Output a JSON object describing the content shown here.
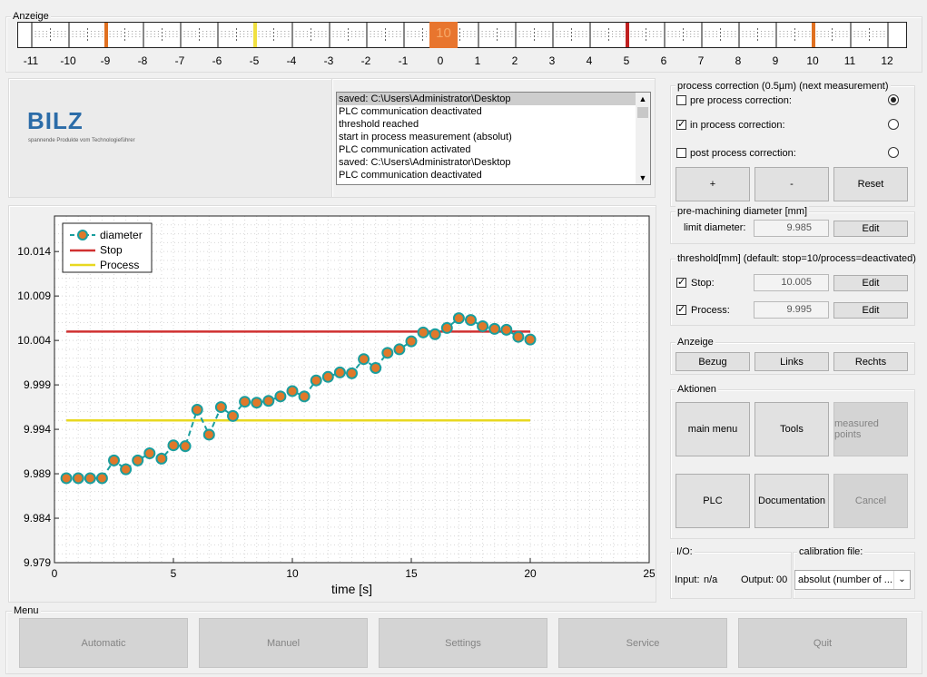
{
  "anzeige": {
    "title": "Anzeige",
    "scale_labels": [
      "-11",
      "-10",
      "-9",
      "-8",
      "-7",
      "-6",
      "-5",
      "-4",
      "-3",
      "-2",
      "-1",
      "0",
      "1",
      "2",
      "3",
      "4",
      "5",
      "6",
      "7",
      "8",
      "9",
      "10",
      "11",
      "12"
    ],
    "indicator_value": "10",
    "markers": [
      {
        "value": -9,
        "color": "#e07020"
      },
      {
        "value": -5,
        "color": "#f0e040"
      },
      {
        "value": 5,
        "color": "#c02020"
      },
      {
        "value": 10,
        "color": "#e07020"
      }
    ]
  },
  "logo": {
    "brand": "BILZ",
    "tagline": "spannende Produkte vom Technologieführer"
  },
  "log": {
    "entries": [
      "saved: C:\\Users\\Administrator\\Desktop",
      "PLC communication deactivated",
      "threshold reached",
      "start in process measurement (absolut)",
      "PLC communication activated",
      "saved: C:\\Users\\Administrator\\Desktop",
      "PLC communication deactivated"
    ]
  },
  "chart_data": {
    "type": "line",
    "xlabel": "time [s]",
    "ylabel": "",
    "xlim": [
      0,
      25
    ],
    "ylim": [
      9.979,
      10.018
    ],
    "x_ticks": [
      "0",
      "5",
      "10",
      "15",
      "20",
      "25"
    ],
    "y_ticks": [
      "9.979",
      "9.984",
      "9.989",
      "9.994",
      "9.999",
      "10.004",
      "10.009",
      "10.014"
    ],
    "legend": [
      "diameter",
      "Stop",
      "Process"
    ],
    "legend_position": "top-left",
    "grid": true,
    "series": [
      {
        "name": "diameter",
        "color": "#1a9e9e",
        "marker_color": "#e0782a",
        "x": [
          0.5,
          1.0,
          1.5,
          2.0,
          2.5,
          3.0,
          3.5,
          4.0,
          4.5,
          5.0,
          5.5,
          6.0,
          6.5,
          7.0,
          7.5,
          8.0,
          8.5,
          9.0,
          9.5,
          10.0,
          10.5,
          11.0,
          11.5,
          12.0,
          12.5,
          13.0,
          13.5,
          14.0,
          14.5,
          15.0,
          15.5,
          16.0,
          16.5,
          17.0,
          17.5,
          18.0,
          18.5,
          19.0,
          19.5,
          20.0
        ],
        "y": [
          9.9885,
          9.9885,
          9.9885,
          9.9885,
          9.9905,
          9.9895,
          9.9905,
          9.9913,
          9.9907,
          9.9922,
          9.9921,
          9.9962,
          9.9934,
          9.9965,
          9.9955,
          9.9971,
          9.997,
          9.9972,
          9.9977,
          9.9983,
          9.9977,
          9.9995,
          9.9999,
          10.0004,
          10.0003,
          10.0019,
          10.0009,
          10.0026,
          10.003,
          10.0039,
          10.0049,
          10.0047,
          10.0054,
          10.0065,
          10.0063,
          10.0056,
          10.0053,
          10.0052,
          10.0044,
          10.0041
        ]
      },
      {
        "name": "Stop",
        "color": "#d03030",
        "x": [
          0.5,
          20.0
        ],
        "y": [
          10.005,
          10.005
        ]
      },
      {
        "name": "Process",
        "color": "#e8d820",
        "x": [
          0.5,
          20.0
        ],
        "y": [
          9.995,
          9.995
        ]
      }
    ]
  },
  "process_correction": {
    "title": "process correction (0.5µm) (next measurement)",
    "options": [
      {
        "label": "pre process correction:",
        "checked": false,
        "radio": true
      },
      {
        "label": "in process correction:",
        "checked": true,
        "radio": false
      },
      {
        "label": "post process correction:",
        "checked": false,
        "radio": false
      }
    ],
    "plus_label": "+",
    "minus_label": "-",
    "reset_label": "Reset"
  },
  "pre_machining": {
    "title": "pre-machining diameter [mm]",
    "limit_label": "limit diameter:",
    "limit_value": "9.985",
    "edit_label": "Edit"
  },
  "threshold": {
    "title": "threshold[mm] (default: stop=10/process=deactivated)",
    "stop_label": "Stop:",
    "stop_value": "10.005",
    "stop_checked": true,
    "process_label": "Process:",
    "process_value": "9.995",
    "process_checked": true,
    "edit_label": "Edit"
  },
  "anzeige_panel": {
    "title": "Anzeige",
    "bezug": "Bezug",
    "links": "Links",
    "rechts": "Rechts"
  },
  "aktionen": {
    "title": "Aktionen",
    "main_menu": "main menu",
    "tools": "Tools",
    "measured_points": "measured points",
    "plc": "PLC",
    "documentation": "Documentation",
    "cancel": "Cancel"
  },
  "io": {
    "title": "I/O:",
    "input_label": "Input:",
    "input_value": "n/a",
    "output_label": "Output:",
    "output_value": "00"
  },
  "calibration": {
    "title": "calibration file:",
    "selected": "absolut (number of ..."
  },
  "menu": {
    "title": "Menu",
    "items": [
      "Automatic",
      "Manuel",
      "Settings",
      "Service",
      "Quit"
    ]
  }
}
